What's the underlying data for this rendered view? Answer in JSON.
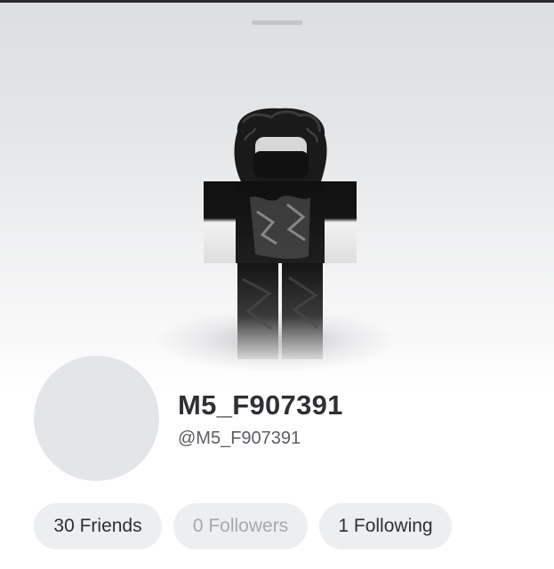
{
  "profile": {
    "display_name": "M5_F907391",
    "username": "@M5_F907391"
  },
  "stats": {
    "friends_label": "30 Friends",
    "followers_label": "0 Followers",
    "following_label": "1 Following"
  },
  "icons": {
    "drag_handle": "drag-handle",
    "avatar": "avatar-3d-figure",
    "profile_picture": "profile-picture-placeholder"
  },
  "colors": {
    "stage_background": "#e4e6e8",
    "pill_background": "#eceef0",
    "text_primary": "#2f3034",
    "text_muted": "#a5a8ad",
    "avatar_placeholder": "#e3e5e8"
  }
}
